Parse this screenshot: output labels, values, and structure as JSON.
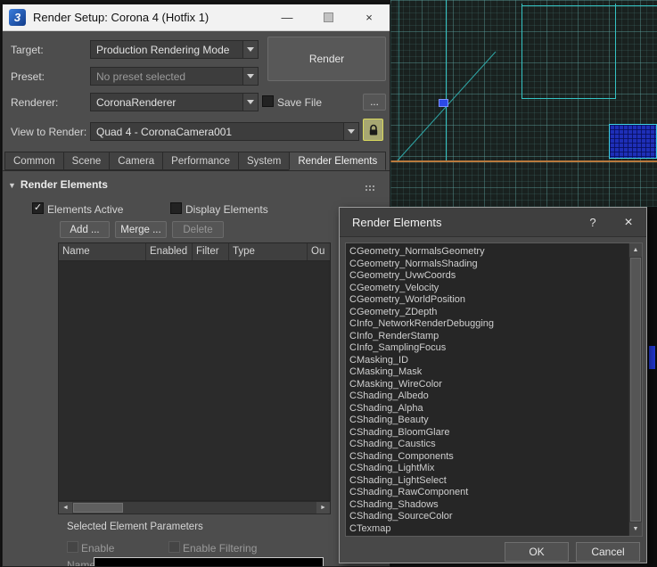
{
  "icons": {
    "minimize": "—",
    "close": "×",
    "help": "?",
    "check": "✓",
    "triangle_down": "▼",
    "arrow_left": "◄",
    "arrow_right": "►",
    "arrow_up": "▲",
    "arrow_down": "▼"
  },
  "render_setup": {
    "app_icon": "3",
    "title": "Render Setup: Corona 4 (Hotfix 1)",
    "fields": [
      {
        "label": "Target:",
        "value": "Production Rendering Mode"
      },
      {
        "label": "Preset:",
        "value": "No preset selected"
      },
      {
        "label": "Renderer:",
        "value": "CoronaRenderer"
      },
      {
        "label": "View to Render:",
        "value": "Quad 4 - CoronaCamera001"
      }
    ],
    "render_button": "Render",
    "save_file_label": "Save File",
    "browse_button": "...",
    "tabs": [
      "Common",
      "Scene",
      "Camera",
      "Performance",
      "System",
      "Render Elements"
    ],
    "active_tab": "Render Elements",
    "rollout_title": "Render Elements",
    "elements_active_label": "Elements Active",
    "display_elements_label": "Display Elements",
    "add_button": "Add ...",
    "merge_button": "Merge ...",
    "delete_button": "Delete",
    "table_headers": [
      "Name",
      "Enabled",
      "Filter",
      "Type",
      "Ou"
    ],
    "group_title": "Selected Element Parameters",
    "enable_label": "Enable",
    "enable_filtering_label": "Enable Filtering",
    "name_label": "Name:",
    "name_value": ""
  },
  "elements_dialog": {
    "title": "Render Elements",
    "items": [
      "CGeometry_NormalsGeometry",
      "CGeometry_NormalsShading",
      "CGeometry_UvwCoords",
      "CGeometry_Velocity",
      "CGeometry_WorldPosition",
      "CGeometry_ZDepth",
      "CInfo_NetworkRenderDebugging",
      "CInfo_RenderStamp",
      "CInfo_SamplingFocus",
      "CMasking_ID",
      "CMasking_Mask",
      "CMasking_WireColor",
      "CShading_Albedo",
      "CShading_Alpha",
      "CShading_Beauty",
      "CShading_BloomGlare",
      "CShading_Caustics",
      "CShading_Components",
      "CShading_LightMix",
      "CShading_LightSelect",
      "CShading_RawComponent",
      "CShading_Shadows",
      "CShading_SourceColor",
      "CTexmap"
    ],
    "ok_button": "OK",
    "cancel_button": "Cancel"
  },
  "colors": {
    "wireframe_cyan": "#35c4c4",
    "spline_orange": "#b97a3e",
    "selection_blue": "#1e2fb8",
    "lock_highlight": "#a7a772"
  }
}
